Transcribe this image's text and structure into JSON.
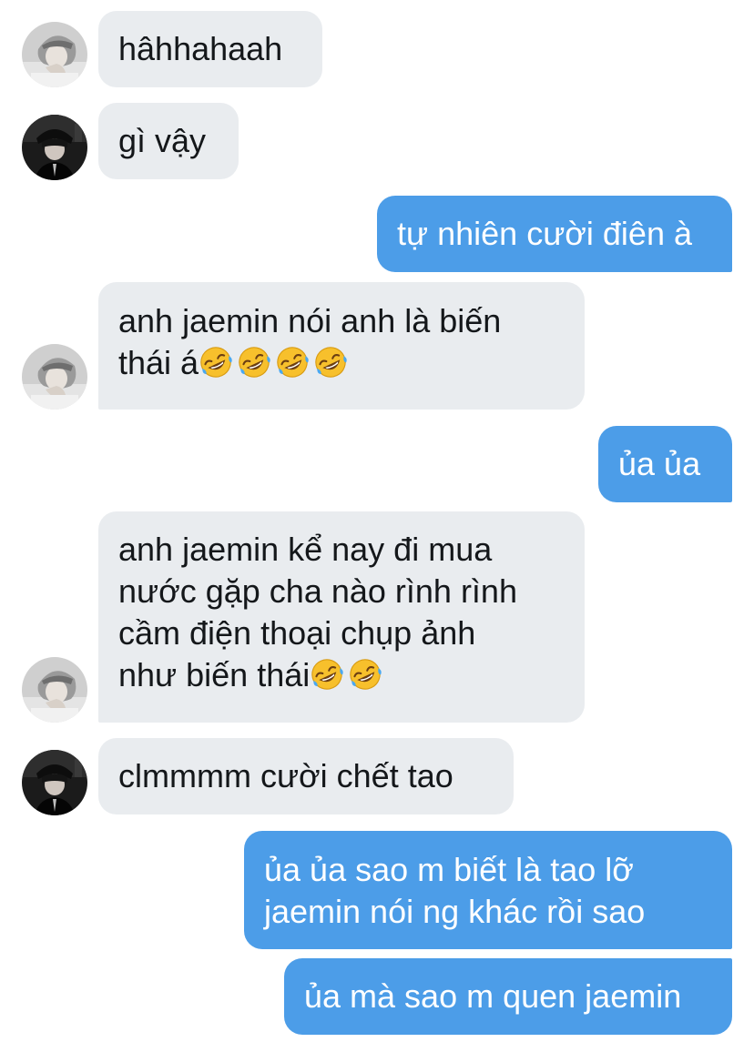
{
  "colors": {
    "incoming_bubble": "#e9ecef",
    "outgoing_bubble": "#4c9de8",
    "incoming_text": "#14171a",
    "outgoing_text": "#ffffff"
  },
  "messages": [
    {
      "sender": "them",
      "avatar": "avatar-grey-photo",
      "lines": [
        "hâhhahaah"
      ]
    },
    {
      "sender": "them",
      "avatar": "avatar-dark-photo",
      "lines": [
        "gì vậy"
      ]
    },
    {
      "sender": "me",
      "lines": [
        "tự nhiên cười điên à"
      ]
    },
    {
      "sender": "them",
      "avatar": "avatar-grey-photo",
      "lines": [
        "anh jaemin nói anh là biến",
        "thái á"
      ],
      "emoji": "rolling-on-floor-laughing-icon",
      "emoji_count": 4
    },
    {
      "sender": "me",
      "lines": [
        "ủa ủa"
      ]
    },
    {
      "sender": "them",
      "avatar": "avatar-grey-photo",
      "lines": [
        "anh jaemin kể nay đi mua",
        "nước gặp cha nào rình rình",
        "cầm điện thoại chụp ảnh",
        "như biến thái"
      ],
      "emoji": "rolling-on-floor-laughing-icon",
      "emoji_count": 2
    },
    {
      "sender": "them",
      "avatar": "avatar-dark-photo",
      "lines": [
        "clmmmm cười chết tao"
      ]
    },
    {
      "sender": "me",
      "lines": [
        "ủa ủa sao m biết là tao lỡ",
        "jaemin nói ng khác rồi sao"
      ]
    },
    {
      "sender": "me",
      "lines": [
        "ủa mà sao m quen jaemin"
      ]
    }
  ]
}
